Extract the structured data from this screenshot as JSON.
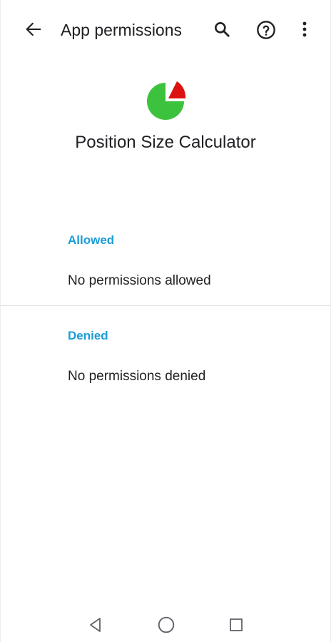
{
  "appbar": {
    "title": "App permissions",
    "icons": [
      "arrow-back-icon",
      "search-icon",
      "help-icon",
      "more-vert-icon"
    ]
  },
  "app": {
    "name": "Position Size Calculator",
    "icon": "pie-chart-icon",
    "colors": {
      "main": "#3cc23c",
      "slice": "#dd1111"
    }
  },
  "sections": {
    "allowed": {
      "title": "Allowed",
      "body": "No permissions allowed"
    },
    "denied": {
      "title": "Denied",
      "body": "No permissions denied"
    }
  },
  "navbar": {
    "icons": [
      "nav-back-icon",
      "nav-home-icon",
      "nav-recents-icon"
    ]
  },
  "colors": {
    "accent": "#1a9dd9",
    "text": "#202124",
    "divider": "#e0e0e0"
  }
}
